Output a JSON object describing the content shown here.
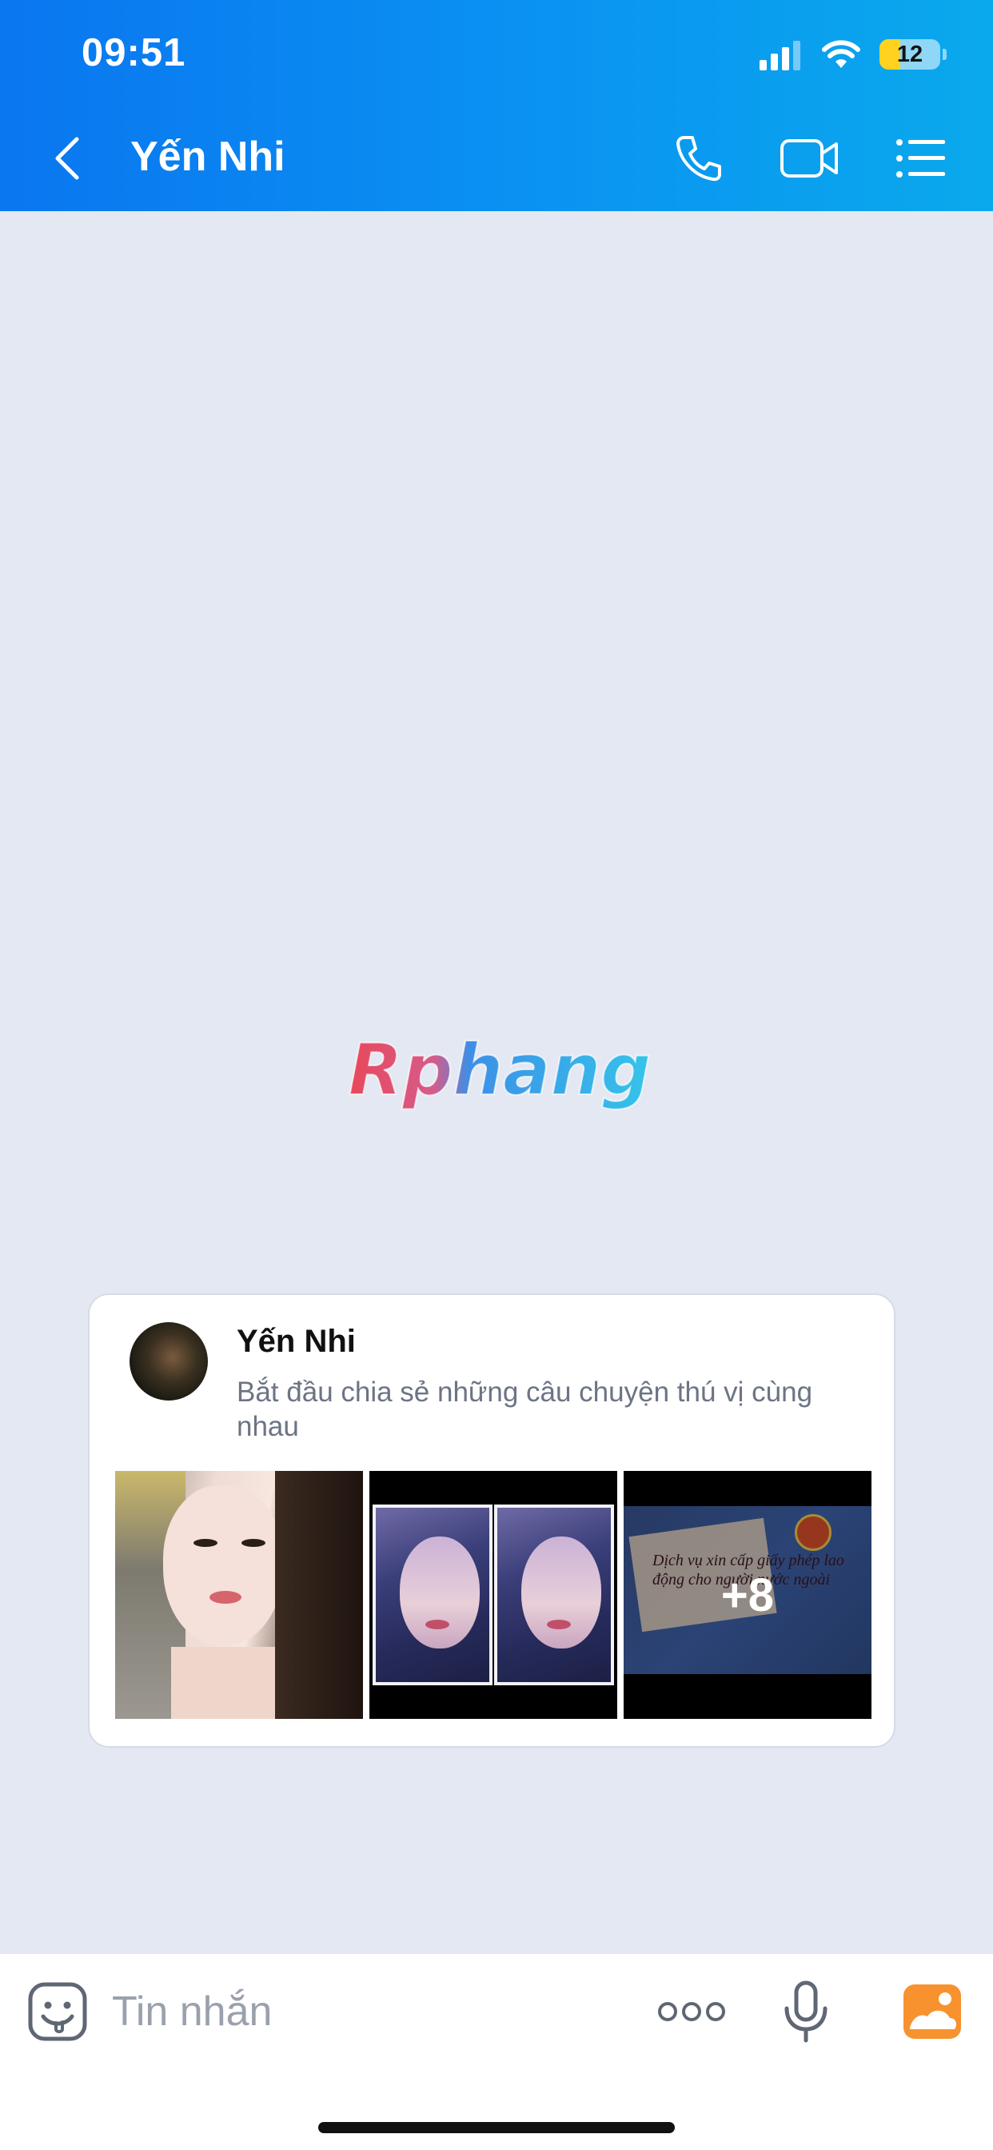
{
  "status_bar": {
    "time": "09:51",
    "battery_level": "12",
    "icons": [
      "cellular-signal-icon",
      "wifi-icon",
      "battery-icon"
    ]
  },
  "header": {
    "contact_name": "Yến Nhi",
    "icons": [
      "back-chevron-icon",
      "phone-call-icon",
      "video-call-icon",
      "menu-list-icon"
    ]
  },
  "watermark": {
    "text": "Rphang"
  },
  "profile_card": {
    "name": "Yến Nhi",
    "description": "Bắt đầu chia sẻ những câu chuyện thú vị cùng nhau",
    "photos": [
      "photo-selfie",
      "photo-collage",
      "photo-document"
    ],
    "document_caption": "Dịch vụ xin cấp giấy phép lao động cho người nước ngoài",
    "more_count": "+8"
  },
  "composer": {
    "placeholder": "Tin nhắn",
    "icons": [
      "sticker-emoji-icon",
      "more-dots-icon",
      "microphone-icon",
      "image-gallery-icon"
    ]
  },
  "colors": {
    "header_start": "#0a76f0",
    "header_end": "#0aa9ec",
    "chat_background": "#e4e8f2",
    "battery_fill": "#ffd21f",
    "gallery_icon": "#f7922e"
  }
}
